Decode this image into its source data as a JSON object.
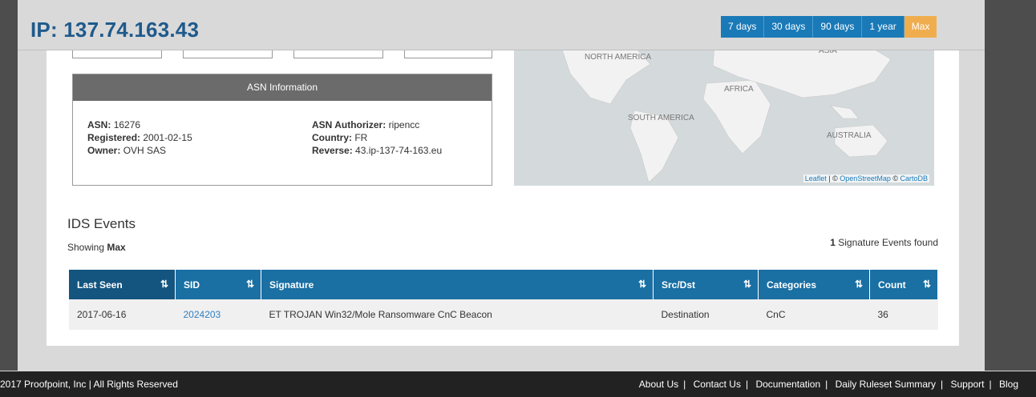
{
  "header": {
    "ip_title": "IP: 137.74.163.43"
  },
  "ranges": [
    {
      "label": "7 days",
      "active": false
    },
    {
      "label": "30 days",
      "active": false
    },
    {
      "label": "90 days",
      "active": false
    },
    {
      "label": "1 year",
      "active": false
    },
    {
      "label": "Max",
      "active": true
    }
  ],
  "asn": {
    "heading": "ASN Information",
    "asn_label": "ASN:",
    "asn_value": "16276",
    "registered_label": "Registered:",
    "registered_value": "2001-02-15",
    "owner_label": "Owner:",
    "owner_value": "OVH SAS",
    "authorizer_label": "ASN Authorizer:",
    "authorizer_value": "ripencc",
    "country_label": "Country:",
    "country_value": "FR",
    "reverse_label": "Reverse:",
    "reverse_value": "43.ip-137-74-163.eu"
  },
  "map": {
    "labels": {
      "north_america": "NORTH AMERICA",
      "africa": "AFRICA",
      "south_america": "SOUTH AMERICA",
      "australia": "AUSTRALIA",
      "asia": "ASIA"
    },
    "attribution_leaflet": "Leaflet",
    "attribution_sep1": " | © ",
    "attribution_osm": "OpenStreetMap",
    "attribution_sep2": " © ",
    "attribution_carto": "CartoDB"
  },
  "ids": {
    "title": "IDS Events",
    "showing_prefix": "Showing ",
    "showing_value": "Max",
    "found_count": "1",
    "found_suffix": " Signature Events found",
    "columns": [
      "Last Seen",
      "SID",
      "Signature",
      "Src/Dst",
      "Categories",
      "Count"
    ],
    "rows": [
      {
        "last_seen": "2017-06-16",
        "sid": "2024203",
        "signature": "ET TROJAN Win32/Mole Ransomware CnC Beacon",
        "srcdst": "Destination",
        "category": "CnC",
        "count": "36"
      }
    ]
  },
  "footer": {
    "copyright": "2017 Proofpoint, Inc  |  All Rights Reserved",
    "links": [
      "About Us",
      "Contact Us",
      "Documentation",
      "Daily Ruleset Summary",
      "Support",
      "Blog"
    ]
  },
  "colors": {
    "accent": "#1a7ab8",
    "active_range": "#f0ad4e",
    "table_header": "#1a6fa3",
    "footer": "#222222"
  }
}
